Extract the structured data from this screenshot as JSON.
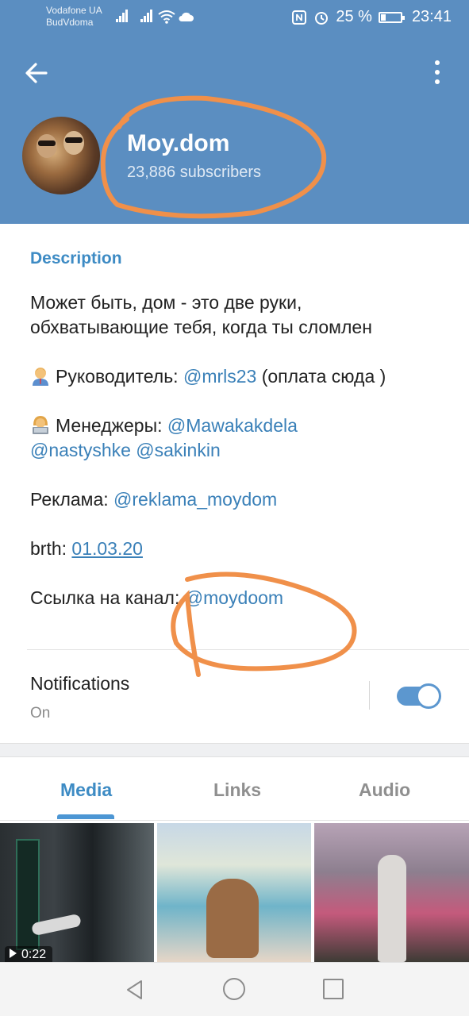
{
  "status_bar": {
    "carrier_1": "Vodafone UA",
    "carrier_2": "BudVdoma",
    "battery": "25 %",
    "time": "23:41"
  },
  "header": {
    "channel_name": "Moy.dom",
    "subscribers": "23,886 subscribers"
  },
  "description": {
    "title": "Description",
    "line1": "Может быть, дом - это две руки, обхватывающие тебя, когда ты сломлен",
    "leader_label": "Руководитель: ",
    "leader_link": "@mrls23",
    "leader_tail": " (оплата сюда )",
    "managers_label": "Менеджеры: ",
    "manager_1": "@Mawakakdela",
    "manager_2": "@nastyshke",
    "manager_3": "@sakinkin",
    "ads_label": "Реклама: ",
    "ads_link": "@reklama_moydom",
    "brth_label": "brth: ",
    "brth_value": "01.03.20",
    "channel_label": "Ссылка на канал: ",
    "channel_link": "@moydoom"
  },
  "notifications": {
    "title": "Notifications",
    "state": "On",
    "enabled": true
  },
  "tabs": [
    {
      "label": "Media",
      "active": true
    },
    {
      "label": "Links",
      "active": false
    },
    {
      "label": "Audio",
      "active": false
    }
  ],
  "media": {
    "video_duration": "0:22"
  },
  "colors": {
    "header_bg": "#5b8ec1",
    "accent": "#3d8bc4",
    "link": "#3a80b8",
    "annotation": "#f0904a"
  },
  "icons": {
    "back": "arrow-left-icon",
    "more": "more-vertical-icon",
    "nav_back": "triangle-back-icon",
    "nav_home": "circle-home-icon",
    "nav_recent": "square-recents-icon"
  }
}
